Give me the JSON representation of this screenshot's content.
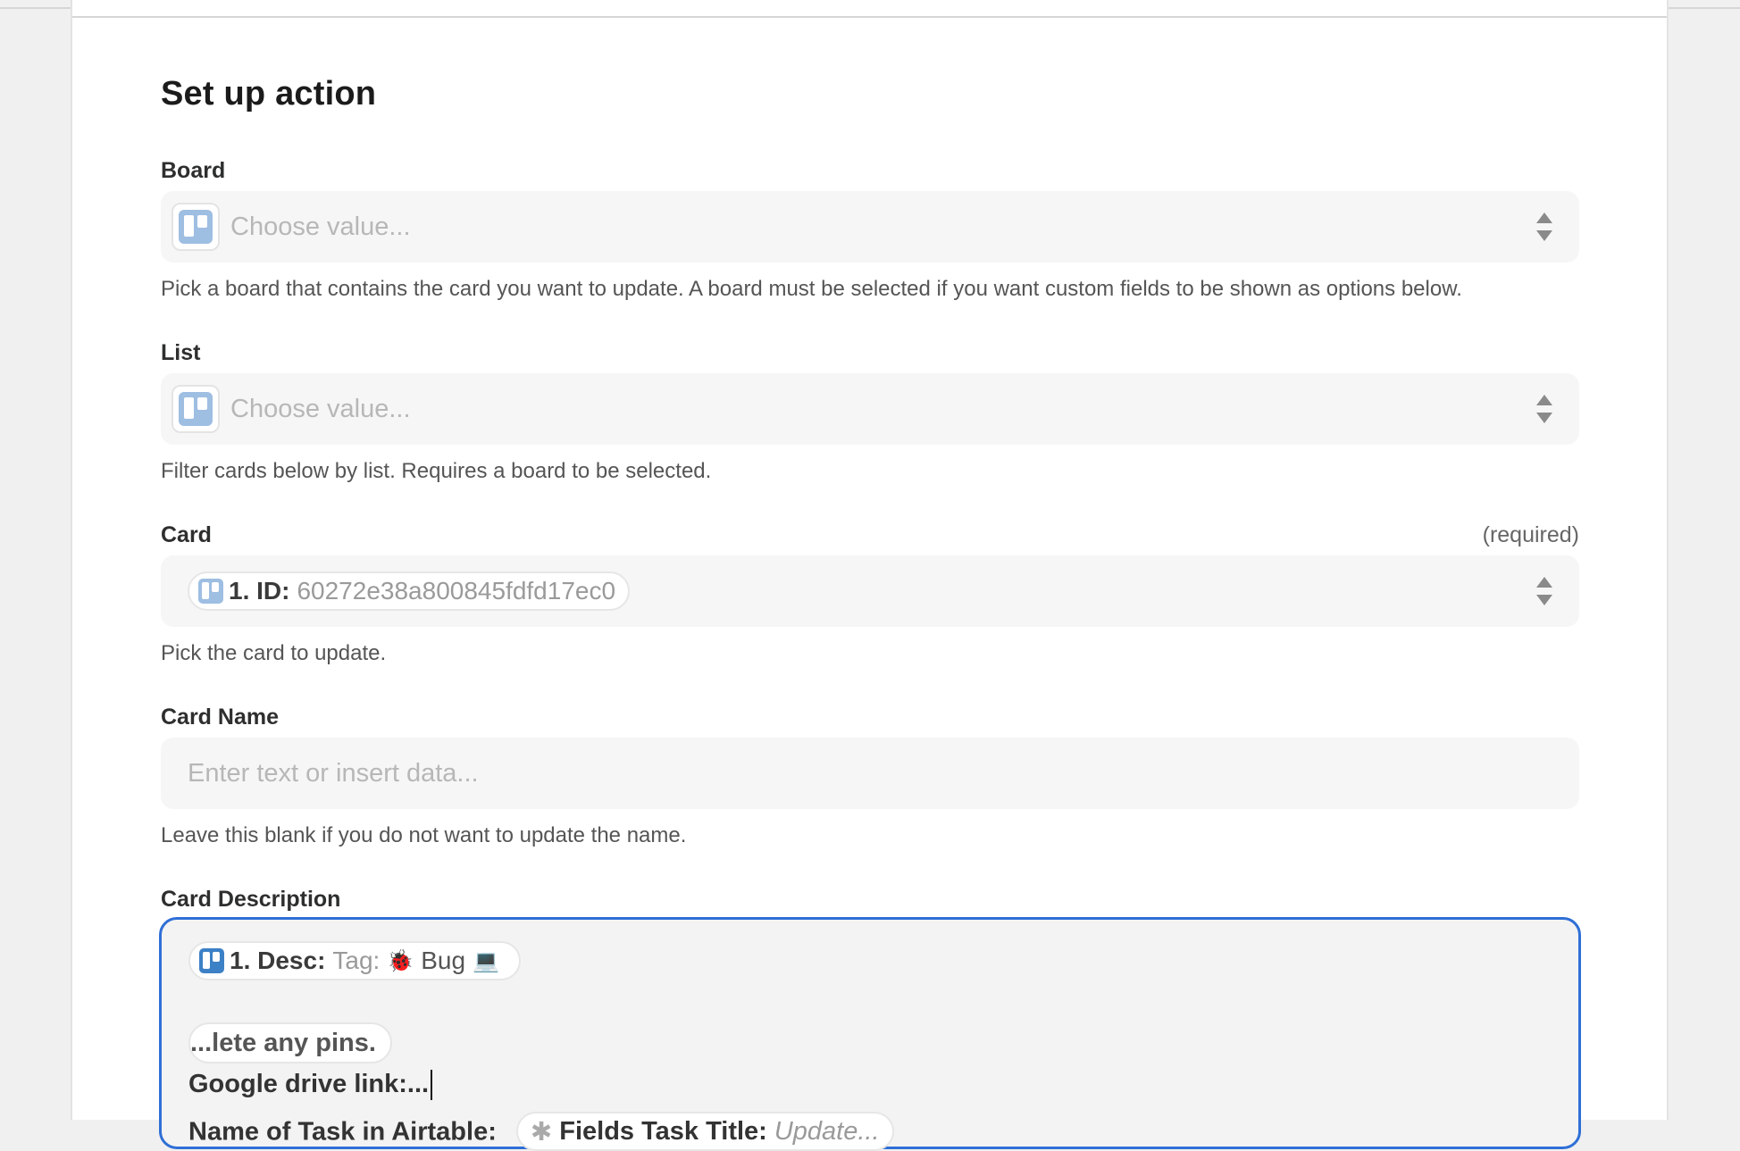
{
  "page": {
    "title": "Set up action"
  },
  "fields": {
    "board": {
      "label": "Board",
      "placeholder": "Choose value...",
      "help": "Pick a board that contains the card you want to update. A board must be selected if you want custom fields to be shown as options below."
    },
    "list": {
      "label": "List",
      "placeholder": "Choose value...",
      "help": "Filter cards below by list. Requires a board to be selected."
    },
    "card": {
      "label": "Card",
      "required": "(required)",
      "value_key": "1. ID:",
      "value": "60272e38a800845fdfd17ec0",
      "help": "Pick the card to update."
    },
    "card_name": {
      "label": "Card Name",
      "placeholder": "Enter text or insert data...",
      "help": "Leave this blank if you do not want to update the name."
    },
    "card_description": {
      "label": "Card Description",
      "pill_key": "1. Desc:",
      "pill_tag": "Tag:",
      "pill_bug_emoji": "🐞",
      "pill_bug": "Bug",
      "pill_laptop_emoji": "💻",
      "partial_text": "...lete any pins.",
      "drive_line": "Google drive link:...",
      "cut_line_text": "Name of Task in Airtable:",
      "cut_pill_key": "Fields Task Title:",
      "cut_pill_value": "Update..."
    }
  },
  "icons": {
    "app_icon": "trello-icon",
    "select_arrows": "updown-arrows-icon"
  },
  "colors": {
    "focus_border": "#2f6fd6",
    "trello_light": "#9ebee2",
    "trello_dark": "#3c80c6"
  }
}
